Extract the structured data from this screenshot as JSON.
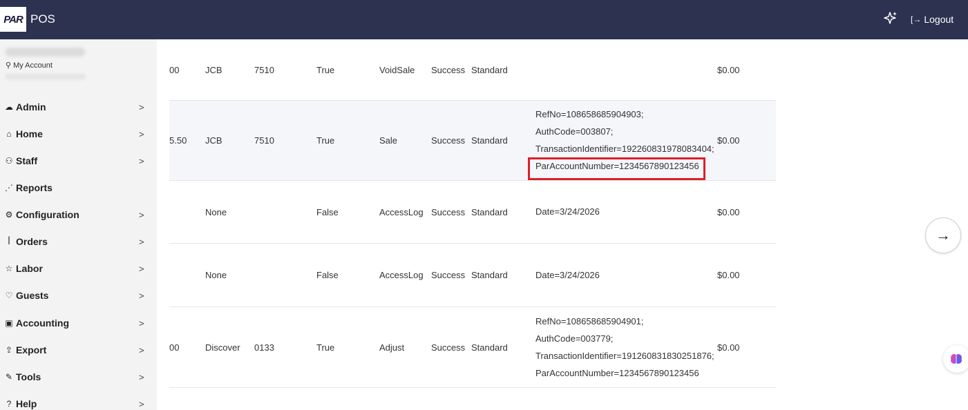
{
  "header": {
    "logo_text": "PAR",
    "app_name": "POS",
    "logout_label": "Logout",
    "logout_icon": "logout-icon",
    "sparkle_icon": "sparkle-icon"
  },
  "sidebar": {
    "my_account_label": "My Account",
    "items": [
      {
        "label": "Admin",
        "icon": "cloud-icon",
        "glyph": "☁",
        "chevron": true
      },
      {
        "label": "Home",
        "icon": "home-icon",
        "glyph": "⌂",
        "chevron": true
      },
      {
        "label": "Staff",
        "icon": "staff-icon",
        "glyph": "⚇",
        "chevron": true
      },
      {
        "label": "Reports",
        "icon": "chart-icon",
        "glyph": "⋰",
        "chevron": false
      },
      {
        "label": "Configuration",
        "icon": "gear-icon",
        "glyph": "⚙",
        "chevron": true
      },
      {
        "label": "Orders",
        "icon": "utensils-icon",
        "glyph": "ꟾ",
        "chevron": true
      },
      {
        "label": "Labor",
        "icon": "star-icon",
        "glyph": "☆",
        "chevron": true
      },
      {
        "label": "Guests",
        "icon": "heart-icon",
        "glyph": "♡",
        "chevron": true
      },
      {
        "label": "Accounting",
        "icon": "money-icon",
        "glyph": "▣",
        "chevron": true
      },
      {
        "label": "Export",
        "icon": "export-icon",
        "glyph": "⇪",
        "chevron": true
      },
      {
        "label": "Tools",
        "icon": "wrench-icon",
        "glyph": "✎",
        "chevron": true
      },
      {
        "label": "Help",
        "icon": "help-icon",
        "glyph": "?",
        "chevron": true
      }
    ]
  },
  "table": {
    "rows": [
      {
        "amount": "00",
        "card": "JCB",
        "last4": "7510",
        "flag": "True",
        "type": "VoidSale",
        "status": "Success",
        "mode": "Standard",
        "details": [],
        "tip": "$0.00"
      },
      {
        "amount": "5.50",
        "card": "JCB",
        "last4": "7510",
        "flag": "True",
        "type": "Sale",
        "status": "Success",
        "mode": "Standard",
        "details": [
          "RefNo=108658685904903;",
          "AuthCode=003807;",
          "TransactionIdentifier=192260831978083404;",
          "ParAccountNumber=1234567890123456"
        ],
        "tip": "$0.00"
      },
      {
        "amount": "",
        "card": "None",
        "last4": "",
        "flag": "False",
        "type": "AccessLog",
        "status": "Success",
        "mode": "Standard",
        "details": [
          "Date=3/24/2026"
        ],
        "tip": "$0.00"
      },
      {
        "amount": "",
        "card": "None",
        "last4": "",
        "flag": "False",
        "type": "AccessLog",
        "status": "Success",
        "mode": "Standard",
        "details": [
          "Date=3/24/2026"
        ],
        "tip": "$0.00"
      },
      {
        "amount": "00",
        "card": "Discover",
        "last4": "0133",
        "flag": "True",
        "type": "Adjust",
        "status": "Success",
        "mode": "Standard",
        "details": [
          "RefNo=108658685904901;",
          "AuthCode=003779;",
          "TransactionIdentifier=191260831830251876;",
          "ParAccountNumber=1234567890123456"
        ],
        "tip": "$0.00"
      }
    ]
  },
  "widgets": {
    "next_arrow": "→",
    "next_icon": "arrow-right-icon",
    "assistant_icon": "brain-icon",
    "highlight_color": "#d9202a",
    "topbar_color": "#2c3250"
  }
}
